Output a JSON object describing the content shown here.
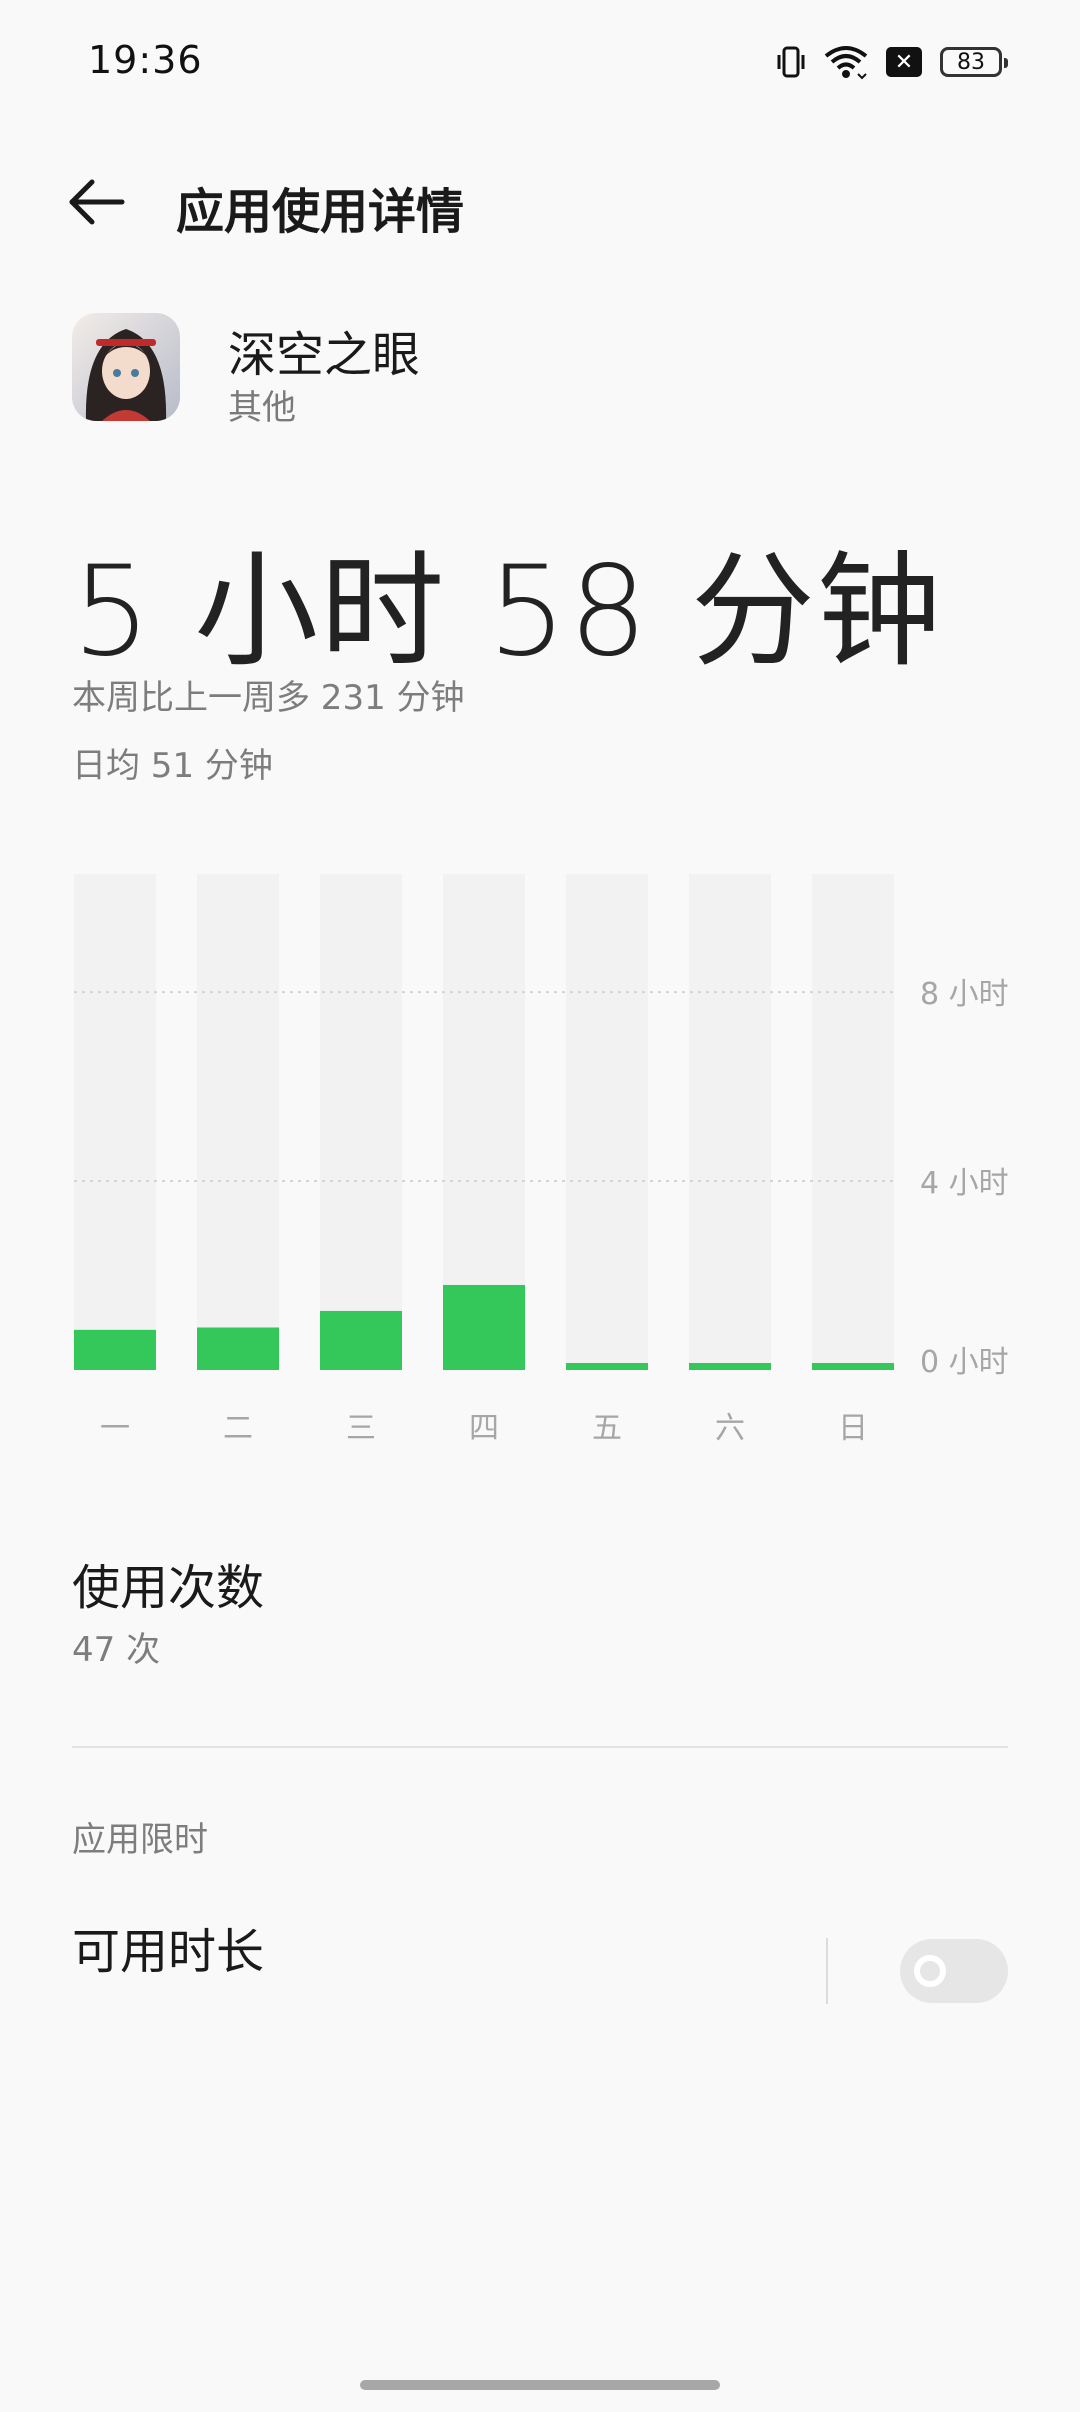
{
  "status_bar": {
    "time": "19:36",
    "battery": "83",
    "icons": [
      "vibrate-icon",
      "wifi-icon",
      "no-sim-icon",
      "battery-icon"
    ]
  },
  "header": {
    "title": "应用使用详情",
    "back_icon": "back-arrow-icon"
  },
  "app": {
    "name": "深空之眼",
    "category": "其他"
  },
  "usage": {
    "total": "5 小时 58 分钟",
    "compare": "本周比上一周多 231 分钟",
    "daily_avg": "日均 51 分钟"
  },
  "chart_data": {
    "type": "bar",
    "categories": [
      "一",
      "二",
      "三",
      "四",
      "五",
      "六",
      "日"
    ],
    "values": [
      0.85,
      0.9,
      1.25,
      1.8,
      0.1,
      0.08,
      0.08
    ],
    "y_ticks": [
      "0 小时",
      "4 小时",
      "8 小时"
    ],
    "ylim": [
      0,
      10.5
    ],
    "grid": true,
    "colors": {
      "bar": "#34c759",
      "track": "#f2f2f2",
      "grid": "#d4d4d4",
      "text": "#a6a6a6"
    }
  },
  "launches": {
    "title": "使用次数",
    "value": "47 次"
  },
  "app_limit": {
    "section_label": "应用限时",
    "item_label": "可用时长",
    "enabled": false
  }
}
